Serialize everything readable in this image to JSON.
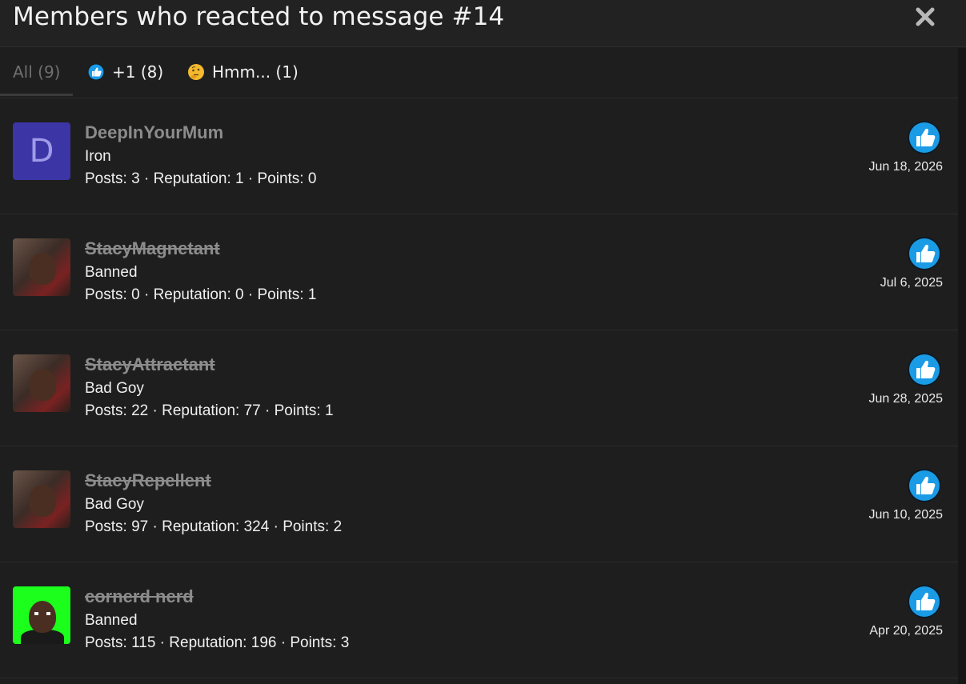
{
  "dialog": {
    "title": "Members who reacted to message #14",
    "close_icon": "close-icon"
  },
  "tabs": [
    {
      "label": "All (9)",
      "icon": null,
      "active": true
    },
    {
      "label": "+1 (8)",
      "icon": "thumbs-up-icon"
    },
    {
      "label": "Hmm... (1)",
      "icon": "thinking-face-icon"
    }
  ],
  "members": [
    {
      "username": "DeepInYourMum",
      "banned": false,
      "avatar": {
        "type": "letter",
        "letter": "D",
        "color": "#3c35a6"
      },
      "rank": "Iron",
      "posts_label": "Posts:",
      "posts": "3",
      "reputation_label": "Reputation:",
      "reputation": "1",
      "points_label": "Points:",
      "points": "0",
      "reaction": "thumbs-up-icon",
      "date": "Jun 18, 2026"
    },
    {
      "username": "StacyMagnetant",
      "banned": true,
      "avatar": {
        "type": "photo"
      },
      "rank": "Banned",
      "posts_label": "Posts:",
      "posts": "0",
      "reputation_label": "Reputation:",
      "reputation": "0",
      "points_label": "Points:",
      "points": "1",
      "reaction": "thumbs-up-icon",
      "date": "Jul 6, 2025"
    },
    {
      "username": "StacyAttractant",
      "banned": true,
      "avatar": {
        "type": "photo"
      },
      "rank": "Bad Goy",
      "posts_label": "Posts:",
      "posts": "22",
      "reputation_label": "Reputation:",
      "reputation": "77",
      "points_label": "Points:",
      "points": "1",
      "reaction": "thumbs-up-icon",
      "date": "Jun 28, 2025"
    },
    {
      "username": "StacyRepellent",
      "banned": true,
      "avatar": {
        "type": "photo"
      },
      "rank": "Bad Goy",
      "posts_label": "Posts:",
      "posts": "97",
      "reputation_label": "Reputation:",
      "reputation": "324",
      "points_label": "Points:",
      "points": "2",
      "reaction": "thumbs-up-icon",
      "date": "Jun 10, 2025"
    },
    {
      "username": "cornerd nerd",
      "banned": true,
      "avatar": {
        "type": "photo",
        "color": "#1cff1c"
      },
      "rank": "Banned",
      "posts_label": "Posts:",
      "posts": "115",
      "reputation_label": "Reputation:",
      "reputation": "196",
      "points_label": "Points:",
      "points": "3",
      "reaction": "thumbs-up-icon",
      "date": "Apr 20, 2025"
    }
  ],
  "colors": {
    "background": "#1e1e1e",
    "header": "#222222",
    "username": "#8c8c8c",
    "like_blue": "#1a9be6"
  }
}
